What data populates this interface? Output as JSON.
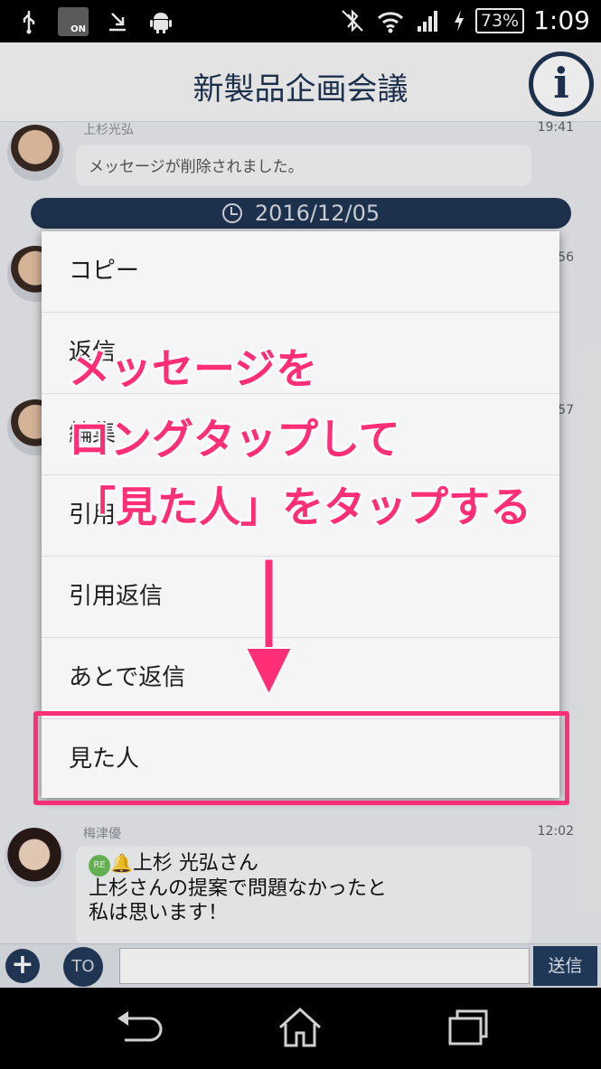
{
  "status_bar": {
    "nfc_label": "ON",
    "battery": "73%",
    "time": "1:09"
  },
  "header": {
    "title": "新製品企画会議",
    "info_label": "i"
  },
  "chat": {
    "msg1": {
      "sender": "上杉光弘",
      "time": "19:41",
      "text": "メッセージが削除されました。"
    },
    "date": "2016/12/05",
    "partial_times": [
      "56",
      "57"
    ],
    "msg_last": {
      "sender": "梅津優",
      "time": "12:02",
      "reply_badge": "RE",
      "reply_to": "上杉 光弘さん",
      "line1": "上杉さんの提案で問題なかったと",
      "line2": "私は思います！"
    }
  },
  "context_menu": {
    "items": [
      {
        "label": "コピー"
      },
      {
        "label": "返信"
      },
      {
        "label": "編集"
      },
      {
        "label": "引用"
      },
      {
        "label": "引用返信"
      },
      {
        "label": "あとで返信"
      },
      {
        "label": "見た人"
      }
    ]
  },
  "annotation": {
    "line1": "メッセージを",
    "line2": "ロングタップして",
    "line3": "「見た人」をタップする",
    "color": "#ff2e77"
  },
  "input_bar": {
    "to_label": "TO",
    "send_label": "送信",
    "placeholder": ""
  }
}
